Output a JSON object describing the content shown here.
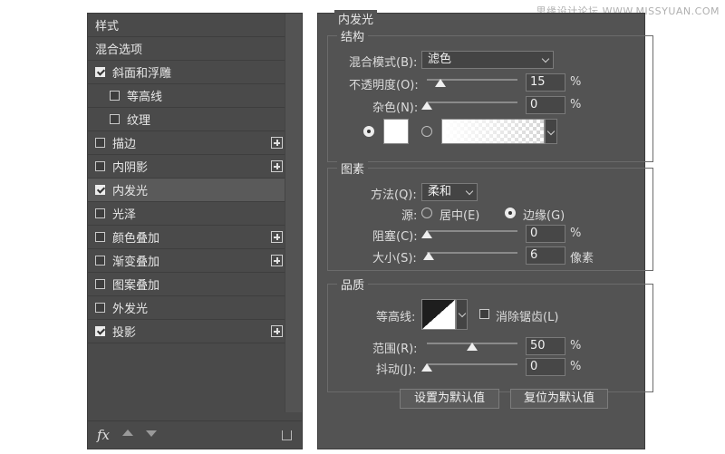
{
  "watermark": "思缘设计论坛 WWW.MISSYUAN.COM",
  "left_panel": {
    "items": [
      {
        "label": "样式",
        "checkbox": false,
        "checked": false,
        "indent": 0,
        "plus": false,
        "selected": false
      },
      {
        "label": "混合选项",
        "checkbox": false,
        "checked": false,
        "indent": 0,
        "plus": false,
        "selected": false
      },
      {
        "label": "斜面和浮雕",
        "checkbox": true,
        "checked": true,
        "indent": 0,
        "plus": false,
        "selected": false
      },
      {
        "label": "等高线",
        "checkbox": true,
        "checked": false,
        "indent": 1,
        "plus": false,
        "selected": false
      },
      {
        "label": "纹理",
        "checkbox": true,
        "checked": false,
        "indent": 1,
        "plus": false,
        "selected": false
      },
      {
        "label": "描边",
        "checkbox": true,
        "checked": false,
        "indent": 0,
        "plus": true,
        "selected": false
      },
      {
        "label": "内阴影",
        "checkbox": true,
        "checked": false,
        "indent": 0,
        "plus": true,
        "selected": false
      },
      {
        "label": "内发光",
        "checkbox": true,
        "checked": true,
        "indent": 0,
        "plus": false,
        "selected": true
      },
      {
        "label": "光泽",
        "checkbox": true,
        "checked": false,
        "indent": 0,
        "plus": false,
        "selected": false
      },
      {
        "label": "颜色叠加",
        "checkbox": true,
        "checked": false,
        "indent": 0,
        "plus": true,
        "selected": false
      },
      {
        "label": "渐变叠加",
        "checkbox": true,
        "checked": false,
        "indent": 0,
        "plus": true,
        "selected": false
      },
      {
        "label": "图案叠加",
        "checkbox": true,
        "checked": false,
        "indent": 0,
        "plus": false,
        "selected": false
      },
      {
        "label": "外发光",
        "checkbox": true,
        "checked": false,
        "indent": 0,
        "plus": false,
        "selected": false
      },
      {
        "label": "投影",
        "checkbox": true,
        "checked": true,
        "indent": 0,
        "plus": true,
        "selected": false
      }
    ],
    "footer": {
      "fx_label": "fx"
    }
  },
  "right_panel": {
    "title": "内发光",
    "structure": {
      "title": "结构",
      "blend_mode_label": "混合模式(B):",
      "blend_mode_value": "滤色",
      "opacity_label": "不透明度(O):",
      "opacity_value": "15",
      "opacity_level": 0.15,
      "noise_label": "杂色(N):",
      "noise_value": "0",
      "noise_level": 0,
      "percent": "%"
    },
    "elements": {
      "title": "图素",
      "method_label": "方法(Q):",
      "method_value": "柔和",
      "source_label": "源:",
      "source_center": "居中(E)",
      "source_edge": "边缘(G)",
      "choke_label": "阻塞(C):",
      "choke_value": "0",
      "choke_level": 0,
      "size_label": "大小(S):",
      "size_value": "6",
      "size_level": 0.024,
      "size_unit": "像素",
      "percent": "%"
    },
    "quality": {
      "title": "品质",
      "contour_label": "等高线:",
      "antialias_label": "消除锯齿(L)",
      "range_label": "范围(R):",
      "range_value": "50",
      "range_level": 0.5,
      "jitter_label": "抖动(J):",
      "jitter_value": "0",
      "jitter_level": 0,
      "percent": "%"
    },
    "buttons": {
      "make_default": "设置为默认值",
      "reset_default": "复位为默认值"
    }
  }
}
